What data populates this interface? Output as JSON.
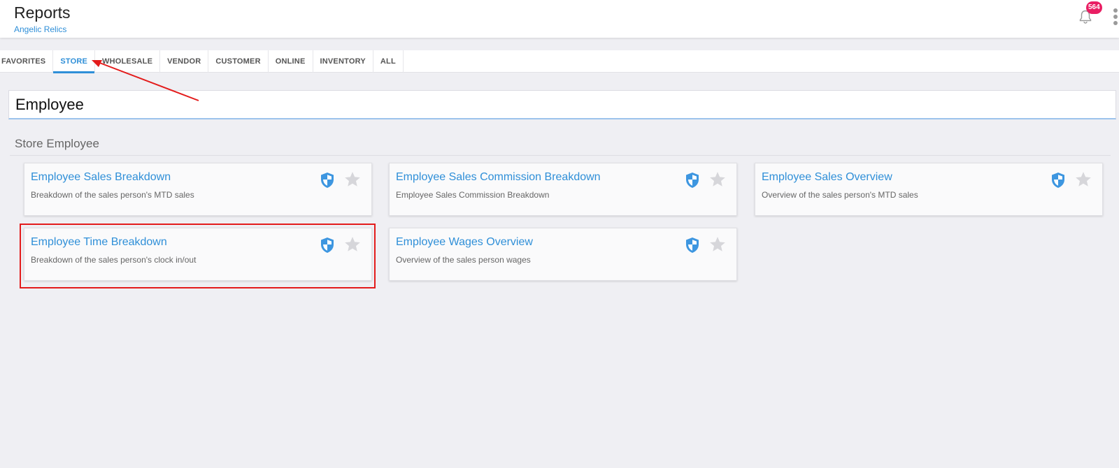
{
  "header": {
    "title": "Reports",
    "subtitle": "Angelic Relics",
    "notification_count": "564"
  },
  "tabs": [
    {
      "label": "FAVORITES"
    },
    {
      "label": "STORE"
    },
    {
      "label": "WHOLESALE"
    },
    {
      "label": "VENDOR"
    },
    {
      "label": "CUSTOMER"
    },
    {
      "label": "ONLINE"
    },
    {
      "label": "INVENTORY"
    },
    {
      "label": "ALL"
    }
  ],
  "active_tab": "STORE",
  "search": {
    "value": "Employee"
  },
  "section": {
    "title": "Store Employee"
  },
  "cards": [
    {
      "title": "Employee Sales Breakdown",
      "description": "Breakdown of the sales person's MTD sales"
    },
    {
      "title": "Employee Sales Commission Breakdown",
      "description": "Employee Sales Commission Breakdown"
    },
    {
      "title": "Employee Sales Overview",
      "description": "Overview of the sales person's MTD sales"
    },
    {
      "title": "Employee Time Breakdown",
      "description": "Breakdown of the sales person's clock in/out"
    },
    {
      "title": "Employee Wages Overview",
      "description": "Overview of the sales person wages"
    }
  ],
  "colors": {
    "accent": "#2f8fd8",
    "badge": "#e91e63",
    "annotation": "#e31b1b"
  }
}
